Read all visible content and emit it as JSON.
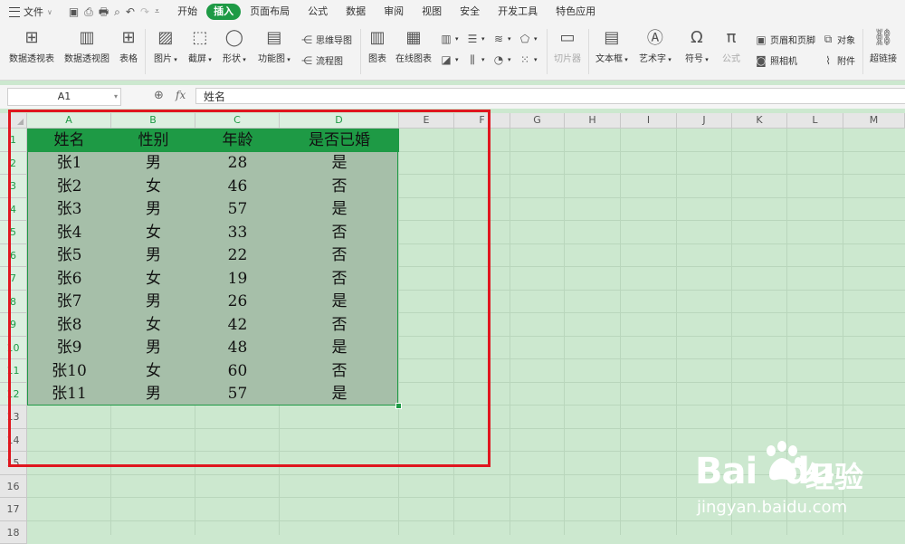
{
  "menubar": {
    "file_label": "文件",
    "tabs": [
      "开始",
      "插入",
      "页面布局",
      "公式",
      "数据",
      "审阅",
      "视图",
      "安全",
      "开发工具",
      "特色应用"
    ],
    "active_tab": "插入",
    "active_color": "#1e9a45"
  },
  "ribbon": {
    "pivot_table": "数据透视表",
    "pivot_chart": "数据透视图",
    "table": "表格",
    "picture": "图片",
    "screenshot": "截屏",
    "shape": "形状",
    "function_chart": "功能图",
    "mindmap": "思维导图",
    "flowchart": "流程图",
    "chart": "图表",
    "online_chart": "在线图表",
    "slicer": "切片器",
    "textbox": "文本框",
    "wordart": "艺术字",
    "symbol": "符号",
    "formula": "公式",
    "header_footer": "页眉和页脚",
    "object": "对象",
    "camera": "照相机",
    "attachment": "附件",
    "hyperlink": "超链接"
  },
  "formula_bar": {
    "name_box": "A1",
    "fx_label": "fx",
    "content": "姓名"
  },
  "columns": [
    "A",
    "B",
    "C",
    "D",
    "E",
    "F",
    "G",
    "H",
    "I",
    "J",
    "K",
    "L",
    "M"
  ],
  "rows": [
    "1",
    "2",
    "3",
    "4",
    "5",
    "6",
    "7",
    "8",
    "9",
    "10",
    "11",
    "12",
    "13",
    "14",
    "15",
    "16",
    "17",
    "18"
  ],
  "table": {
    "headers": [
      "姓名",
      "性别",
      "年龄",
      "是否已婚"
    ],
    "rows": [
      [
        "张1",
        "男",
        "28",
        "是"
      ],
      [
        "张2",
        "女",
        "46",
        "否"
      ],
      [
        "张3",
        "男",
        "57",
        "是"
      ],
      [
        "张4",
        "女",
        "33",
        "否"
      ],
      [
        "张5",
        "男",
        "22",
        "否"
      ],
      [
        "张6",
        "女",
        "19",
        "否"
      ],
      [
        "张7",
        "男",
        "26",
        "是"
      ],
      [
        "张8",
        "女",
        "42",
        "否"
      ],
      [
        "张9",
        "男",
        "48",
        "是"
      ],
      [
        "张10",
        "女",
        "60",
        "否"
      ],
      [
        "张11",
        "男",
        "57",
        "是"
      ]
    ]
  },
  "watermark": {
    "brand": "Bai",
    "brand_suffix": "du",
    "cn": "经验",
    "url": "jingyan.baidu.com"
  },
  "colors": {
    "sheet_bg": "#cce8cf",
    "header_fill": "#1e9a45",
    "selection_fill": "#a6bfa9",
    "highlight_box": "#e0161f"
  }
}
